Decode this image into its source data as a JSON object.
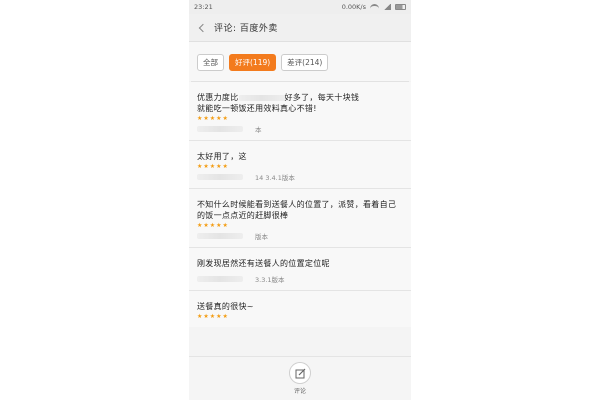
{
  "status_bar": {
    "time": "23:21",
    "speed": "0.00K/s"
  },
  "header": {
    "title": "评论: 百度外卖",
    "back_icon": "chevron-left-icon"
  },
  "tabs": [
    {
      "label": "全部",
      "active": false
    },
    {
      "label": "好评(119)",
      "active": true
    },
    {
      "label": "差评(214)",
      "active": false
    }
  ],
  "reviews": [
    {
      "text_a": "优惠力度比",
      "text_b": "好多了，每天十块钱",
      "line2": "就能吃一顿饭还用效料真心不错!",
      "stars": "★★★★★",
      "meta": "本"
    },
    {
      "text": "太好用了，这",
      "stars": "★★★★★",
      "meta": "14  3.4.1版本"
    },
    {
      "text": "不知什么时候能看到送餐人的位置了，派赞，看着自己的饭一点点近的赶脚很棒",
      "stars": "★★★★★",
      "meta": "版本"
    },
    {
      "text": "刚发现居然还有送餐人的位置定位呢",
      "stars": "",
      "meta": "3.3.1版本"
    },
    {
      "text": "送餐真的很快~",
      "stars": "★★★★★",
      "meta": ""
    }
  ],
  "bottom": {
    "comment_label": "评论",
    "comment_icon": "edit-icon"
  },
  "colors": {
    "accent": "#f37b1d",
    "star": "#f39c12"
  }
}
